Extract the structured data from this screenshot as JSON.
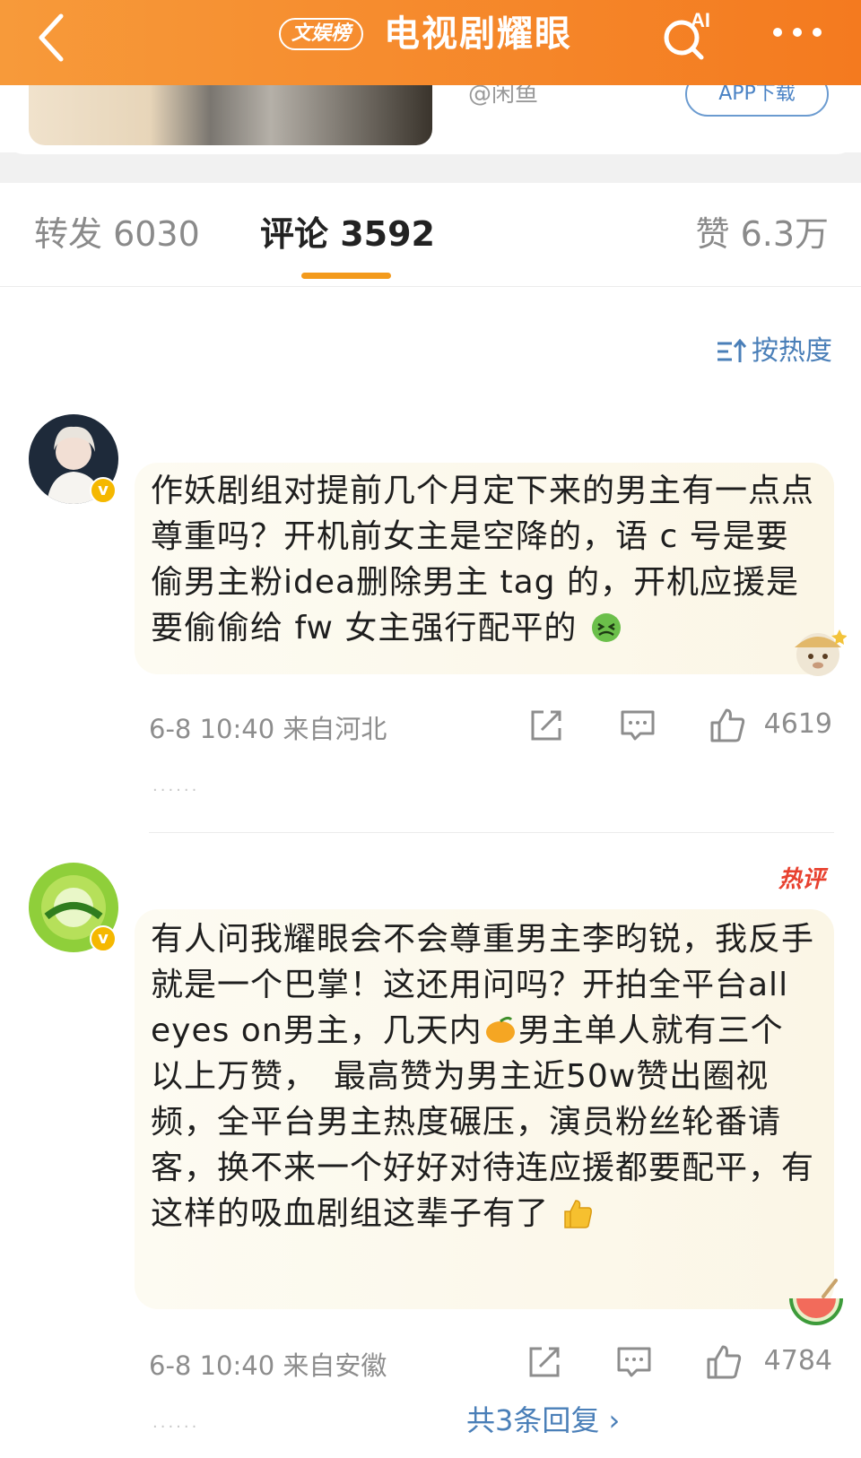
{
  "header": {
    "brand_badge": "文娱榜",
    "title": "电视剧耀眼",
    "ai_label": "AI"
  },
  "top_card": {
    "author_handle": "@闲鱼",
    "app_download": "APP下载"
  },
  "tabs": {
    "repost": "转发 6030",
    "comment": "评论 3592",
    "like": "赞 6.3万"
  },
  "sort_label": "按热度",
  "comments": [
    {
      "text": "作妖剧组对提前几个月定下来的男主有一点点尊重吗？开机前女主是空降的，语 c 号是要偷男主粉idea删除男主 tag 的，开机应援是要偷偷给 fw 女主强行配平的",
      "time": "6-8 10:40 来自河北",
      "likes": "4619",
      "dots": "......"
    },
    {
      "hot_badge": "热评",
      "text_part1": "有人问我耀眼会不会尊重男主李昀锐，我反手就是一个巴掌！这还用问吗？开拍全平台all eyes on男主，几天内",
      "text_part2": "男主单人就有三个以上万赞，　最高赞为男主近50w赞出圈视频，全平台男主热度碾压，演员粉丝轮番请客，换不来一个好好对待连应援都要配平，有这样的吸血剧组这辈子有了",
      "time": "6-8 10:40 来自安徽",
      "likes": "4784",
      "dots": "......",
      "replies_link": "共3条回复 ›"
    }
  ]
}
